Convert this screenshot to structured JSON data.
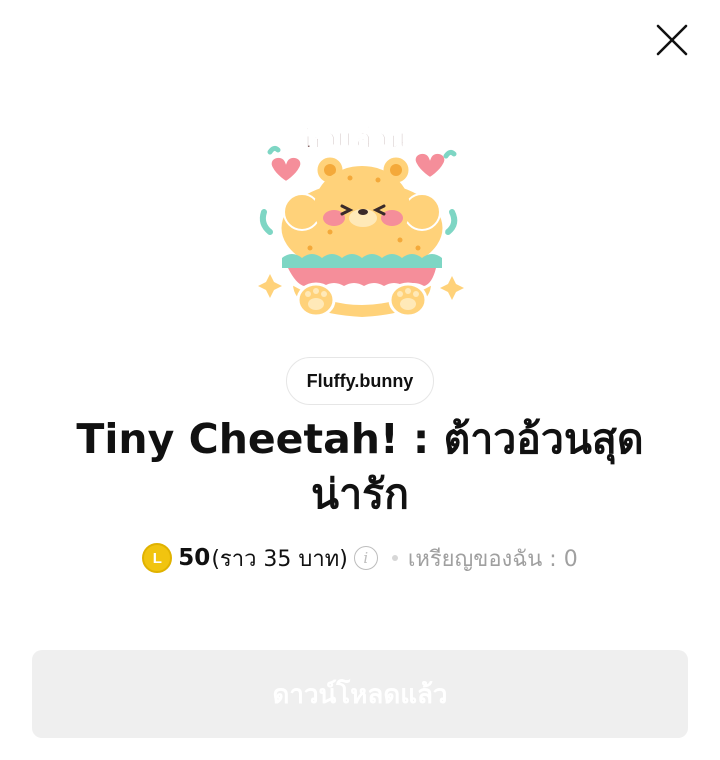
{
  "header": {
    "close_icon": "close-icon"
  },
  "sticker": {
    "caption": "หิวแล้วนะ",
    "icon": "cheetah-sticker-icon",
    "colors": {
      "body": "#FFD27A",
      "spots": "#F4A93A",
      "blush": "#F58E9A",
      "lettuce": "#7ED6C4",
      "heart": "#F58E9A",
      "text": "#8B6A6A"
    }
  },
  "product": {
    "author": "Fluffy.bunny",
    "title": "Tiny Cheetah! : ต้าวอ้วนสุดน่ารัก",
    "coin_symbol": "L",
    "price": "50",
    "price_approx": "(ราว 35 บาท)",
    "info_icon": "i",
    "my_coins_label": "เหรียญของฉัน : 0"
  },
  "actions": {
    "download_label": "ดาวน์โหลดแล้ว"
  },
  "colors": {
    "coin": "#F1C40F",
    "button_bg": "#EFEFEF",
    "muted_text": "#A0A0A0"
  }
}
